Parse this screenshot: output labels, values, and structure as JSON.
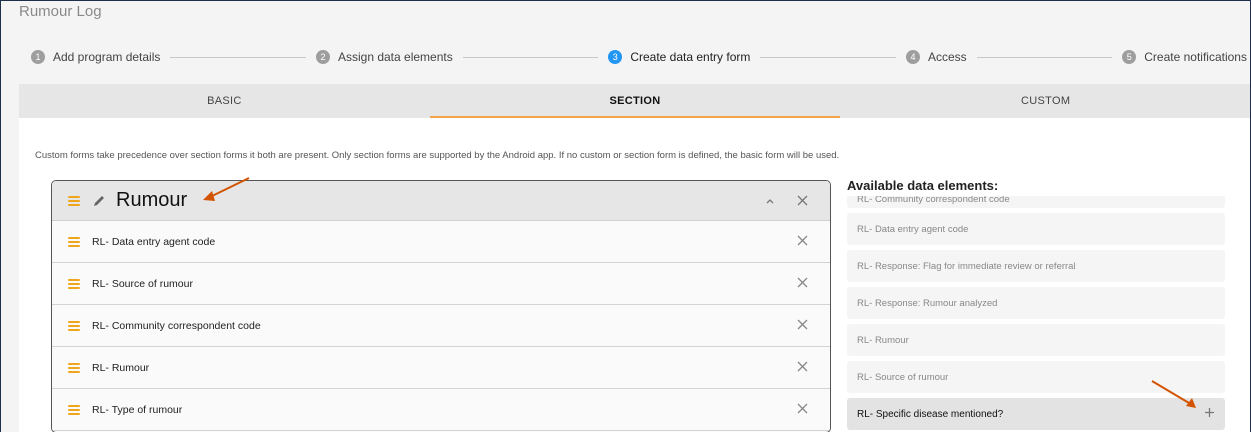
{
  "app": {
    "title": "Rumour Log"
  },
  "stepper": [
    {
      "num": "1",
      "label": "Add program details",
      "active": false
    },
    {
      "num": "2",
      "label": "Assign data elements",
      "active": false
    },
    {
      "num": "3",
      "label": "Create data entry form",
      "active": true
    },
    {
      "num": "4",
      "label": "Access",
      "active": false
    },
    {
      "num": "5",
      "label": "Create notifications",
      "active": false
    }
  ],
  "tabs": [
    {
      "label": "BASIC",
      "active": false
    },
    {
      "label": "SECTION",
      "active": true
    },
    {
      "label": "CUSTOM",
      "active": false
    }
  ],
  "info": "Custom forms take precedence over section forms it both are present. Only section forms are supported by the Android app. If no custom or section form is defined, the basic form will be used.",
  "section": {
    "title": "Rumour",
    "elements": [
      "RL- Data entry agent code",
      "RL- Source of rumour",
      "RL- Community correspondent code",
      "RL- Rumour",
      "RL- Type of rumour"
    ]
  },
  "available": {
    "title": "Available data elements:",
    "items": [
      {
        "label": "RL- Community correspondent code",
        "selected": false,
        "partial": true
      },
      {
        "label": "RL- Data entry agent code",
        "selected": false
      },
      {
        "label": "RL- Response: Flag for immediate review or referral",
        "selected": false
      },
      {
        "label": "RL- Response: Rumour analyzed",
        "selected": false
      },
      {
        "label": "RL- Rumour",
        "selected": false
      },
      {
        "label": "RL- Source of rumour",
        "selected": false
      },
      {
        "label": "RL- Specific disease mentioned?",
        "selected": true
      }
    ]
  },
  "colors": {
    "accent_orange": "#f2a54b",
    "drag_icon": "#f0a61a",
    "annotation_arrow": "#d35400",
    "active_step": "#2196f3"
  }
}
